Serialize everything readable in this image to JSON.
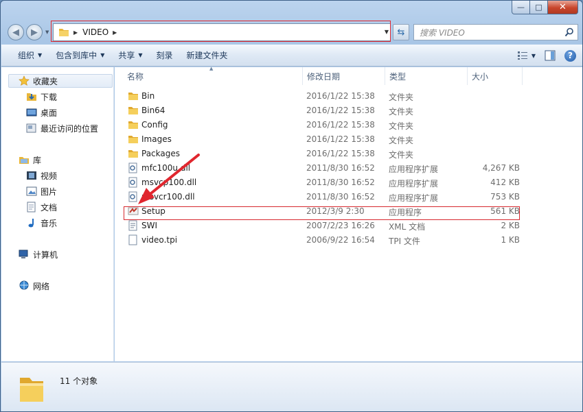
{
  "window": {
    "caption": {
      "minimize": "—",
      "maximize": "□",
      "close": "✕"
    }
  },
  "address": {
    "crumb": "VIDEO",
    "search_placeholder": "搜索 VIDEO"
  },
  "toolbar": {
    "organize": "组织",
    "include_library": "包含到库中",
    "share": "共享",
    "burn": "刻录",
    "new_folder": "新建文件夹",
    "help": "?"
  },
  "sidebar": {
    "favorites": "收藏夹",
    "downloads": "下载",
    "desktop": "桌面",
    "recent": "最近访问的位置",
    "libraries": "库",
    "videos": "视频",
    "pictures": "图片",
    "documents": "文档",
    "music": "音乐",
    "computer": "计算机",
    "network": "网络"
  },
  "columns": {
    "name": "名称",
    "date": "修改日期",
    "type": "类型",
    "size": "大小"
  },
  "files": [
    {
      "name": "Bin",
      "date": "2016/1/22 15:38",
      "type": "文件夹",
      "size": "",
      "icon": "folder-icon"
    },
    {
      "name": "Bin64",
      "date": "2016/1/22 15:38",
      "type": "文件夹",
      "size": "",
      "icon": "folder-icon"
    },
    {
      "name": "Config",
      "date": "2016/1/22 15:38",
      "type": "文件夹",
      "size": "",
      "icon": "folder-icon"
    },
    {
      "name": "Images",
      "date": "2016/1/22 15:38",
      "type": "文件夹",
      "size": "",
      "icon": "folder-icon"
    },
    {
      "name": "Packages",
      "date": "2016/1/22 15:38",
      "type": "文件夹",
      "size": "",
      "icon": "folder-icon"
    },
    {
      "name": "mfc100u.dll",
      "date": "2011/8/30 16:52",
      "type": "应用程序扩展",
      "size": "4,267 KB",
      "icon": "dll-icon"
    },
    {
      "name": "msvcp100.dll",
      "date": "2011/8/30 16:52",
      "type": "应用程序扩展",
      "size": "412 KB",
      "icon": "dll-icon"
    },
    {
      "name": "msvcr100.dll",
      "date": "2011/8/30 16:52",
      "type": "应用程序扩展",
      "size": "753 KB",
      "icon": "dll-icon"
    },
    {
      "name": "Setup",
      "date": "2012/3/9 2:30",
      "type": "应用程序",
      "size": "561 KB",
      "icon": "setup-exe-icon"
    },
    {
      "name": "SWI",
      "date": "2007/2/23 16:26",
      "type": "XML 文档",
      "size": "2 KB",
      "icon": "xml-file-icon"
    },
    {
      "name": "video.tpi",
      "date": "2006/9/22 16:54",
      "type": "TPI 文件",
      "size": "1 KB",
      "icon": "generic-file-icon"
    }
  ],
  "status": {
    "count": "11 个对象"
  },
  "colors": {
    "highlight_red": "#d6272d",
    "folder_yellow": "#f2c94c"
  }
}
